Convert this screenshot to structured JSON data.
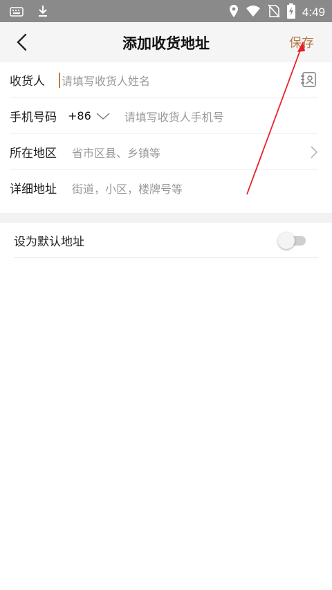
{
  "status_bar": {
    "time": "4:49",
    "left_icons": [
      "keyboard-icon",
      "download-icon"
    ],
    "right_icons": [
      "location-icon",
      "wifi-icon",
      "no-sim-icon",
      "battery-charging-icon"
    ]
  },
  "header": {
    "title": "添加收货地址",
    "save_label": "保存"
  },
  "form": {
    "recipient": {
      "label": "收货人",
      "placeholder": "请填写收货人姓名"
    },
    "phone": {
      "label": "手机号码",
      "country_code": "+86",
      "placeholder": "请填写收货人手机号"
    },
    "region": {
      "label": "所在地区",
      "placeholder": "省市区县、乡镇等"
    },
    "address": {
      "label": "详细地址",
      "placeholder": "街道，小区，楼牌号等"
    }
  },
  "default_address": {
    "label": "设为默认地址",
    "enabled": false
  },
  "colors": {
    "accent": "#b8794a",
    "annotation_arrow": "#e8202a",
    "status_bar": "#8a8a8a"
  }
}
